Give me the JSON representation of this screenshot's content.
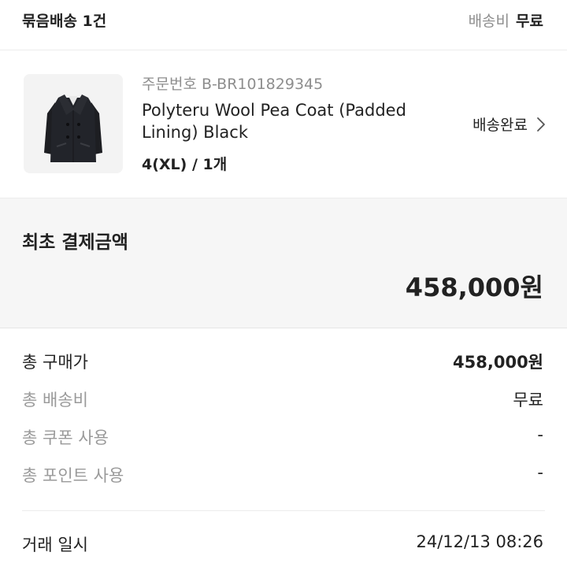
{
  "header": {
    "bundle_title": "묶음배송 1건",
    "shipping_label": "배송비",
    "shipping_value": "무료"
  },
  "product": {
    "order_number": "주문번호 B-BR101829345",
    "name": "Polyteru Wool Pea Coat (Padded Lining) Black",
    "option": "4(XL) / 1개",
    "status": "배송완료",
    "image_icon": "coat-image"
  },
  "payment": {
    "title": "최초 결제금액",
    "amount": "458,000원"
  },
  "summary": [
    {
      "label": "총 구매가",
      "value": "458,000원"
    },
    {
      "label": "총 배송비",
      "value": "무료"
    },
    {
      "label": "총 쿠폰 사용",
      "value": "-"
    },
    {
      "label": "총 포인트 사용",
      "value": "-"
    }
  ],
  "trade": {
    "label": "거래 일시",
    "value": "24/12/13 08:26"
  },
  "colors": {
    "text": "#222222",
    "muted": "#8e8e8e",
    "panel": "#f6f6f6"
  }
}
